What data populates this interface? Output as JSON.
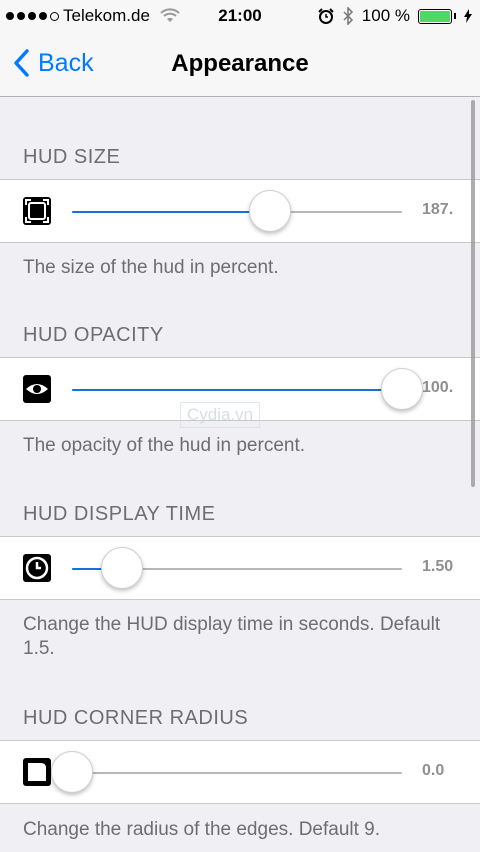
{
  "status_bar": {
    "carrier": "Telekom.de",
    "time": "21:00",
    "battery_percent": "100 %",
    "signal_bars_filled": 4,
    "battery_level": 1.0,
    "battery_color": "#4cd964",
    "icons": [
      "signal-dots-icon",
      "wifi-icon",
      "alarm-icon",
      "bluetooth-icon",
      "battery-icon"
    ]
  },
  "nav": {
    "back_label": "Back",
    "title": "Appearance",
    "accent": "#007aff"
  },
  "sections": [
    {
      "header": "HUD SIZE",
      "icon": "resize-frame-icon",
      "value_label": "187.",
      "slider_fraction": 0.6,
      "footer": "The size of the hud in percent."
    },
    {
      "header": "HUD OPACITY",
      "icon": "eye-icon",
      "value_label": "100.",
      "slider_fraction": 1.0,
      "footer": "The opacity of the hud in percent."
    },
    {
      "header": "HUD DISPLAY TIME",
      "icon": "clock-icon",
      "value_label": "1.50",
      "slider_fraction": 0.153,
      "footer": "Change the HUD display time in seconds. Default 1.5."
    },
    {
      "header": "HUD CORNER RADIUS",
      "icon": "corner-radius-icon",
      "value_label": "0.0",
      "slider_fraction": 0.0,
      "footer": "Change the radius of the edges. Default 9."
    }
  ],
  "slider_color": "#1b6fd8",
  "watermark": "Cydia.vn"
}
